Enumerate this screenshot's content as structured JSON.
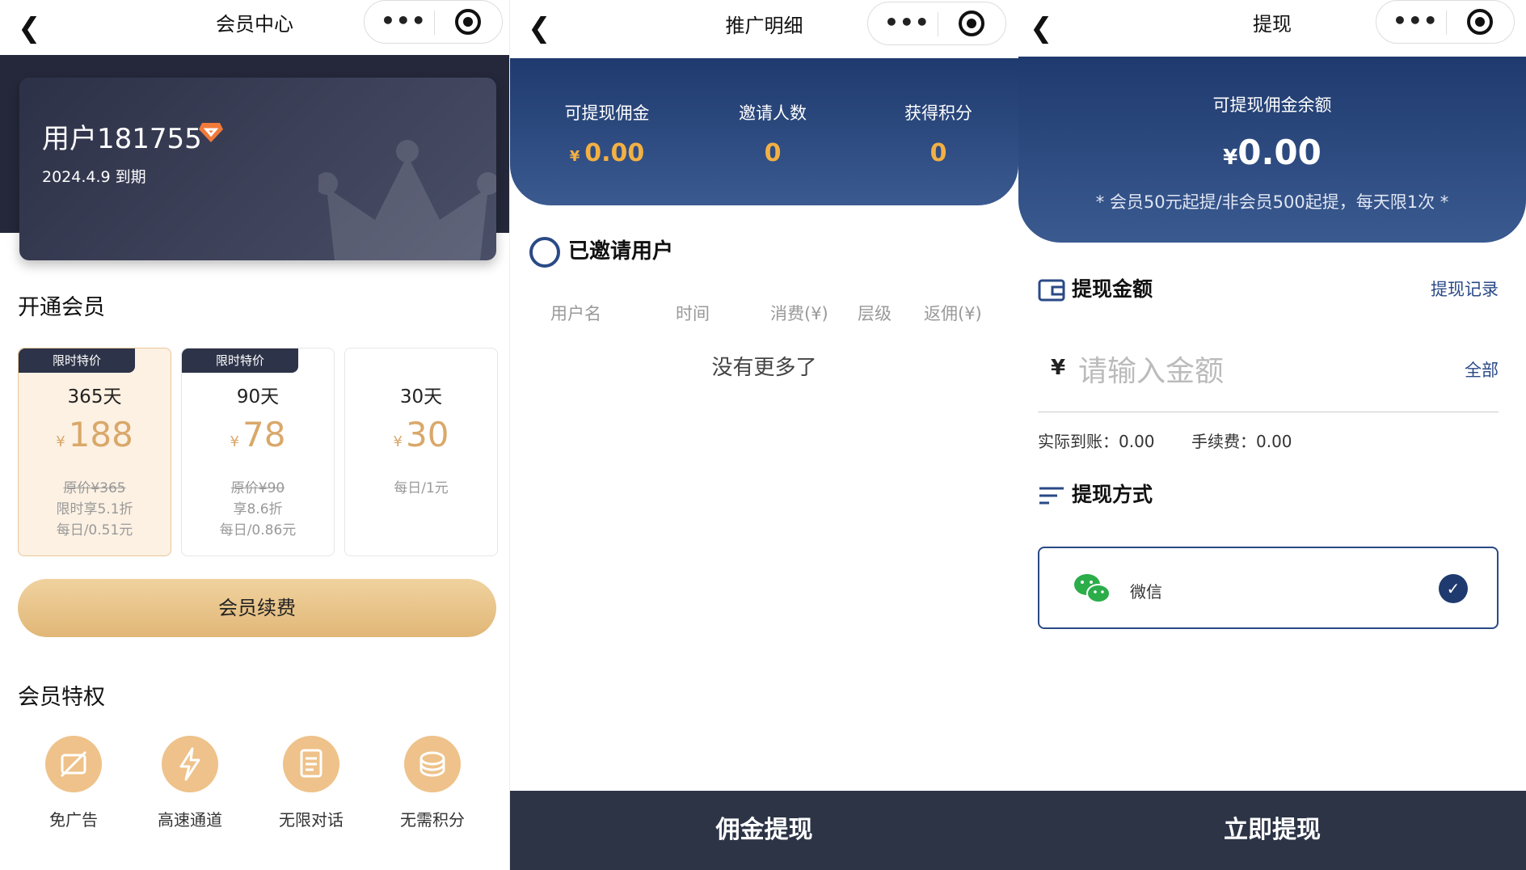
{
  "screen1": {
    "title": "会员中心",
    "user": {
      "name": "用户181755",
      "expiry": "2024.4.9 到期"
    },
    "open_title": "开通会员",
    "plans": [
      {
        "badge": "限时特价",
        "days": "365天",
        "currency": "¥",
        "price": "188",
        "orig": "原价¥365",
        "discount": "限时享5.1折",
        "daily": "每日/0.51元",
        "selected": true
      },
      {
        "badge": "限时特价",
        "days": "90天",
        "currency": "¥",
        "price": "78",
        "orig": "原价¥90",
        "discount": "享8.6折",
        "daily": "每日/0.86元",
        "selected": false
      },
      {
        "badge": "",
        "days": "30天",
        "currency": "¥",
        "price": "30",
        "orig": "",
        "discount": "",
        "daily": "每日/1元",
        "selected": false
      }
    ],
    "renew_label": "会员续费",
    "priv_title": "会员特权",
    "privileges": [
      {
        "label": "免广告",
        "icon": "no-ad-icon"
      },
      {
        "label": "高速通道",
        "icon": "lightning-icon"
      },
      {
        "label": "无限对话",
        "icon": "document-icon"
      },
      {
        "label": "无需积分",
        "icon": "coins-icon"
      }
    ],
    "colors": {
      "gold": "#d9a86a",
      "dark": "#2d3147"
    }
  },
  "screen2": {
    "title": "推广明细",
    "stats": [
      {
        "label": "可提现佣金",
        "currency": "¥",
        "value": "0.00"
      },
      {
        "label": "邀请人数",
        "currency": "",
        "value": "0"
      },
      {
        "label": "获得积分",
        "currency": "",
        "value": "0"
      }
    ],
    "section_title": "已邀请用户",
    "columns": [
      "用户名",
      "时间",
      "消费(¥)",
      "层级",
      "返佣(¥)"
    ],
    "empty": "没有更多了",
    "bottom_button": "佣金提现"
  },
  "screen3": {
    "title": "提现",
    "balance_label": "可提现佣金余额",
    "currency": "¥",
    "balance": "0.00",
    "note": "* 会员50元起提/非会员500起提，每天限1次 *",
    "amount_title": "提现金额",
    "record_link": "提现记录",
    "input_placeholder": "请输入金额",
    "all_label": "全部",
    "actual": "实际到账：0.00",
    "fee": "手续费：0.00",
    "method_title": "提现方式",
    "method": "微信",
    "bottom_button": "立即提现",
    "colors": {
      "navy": "#1f3a6e",
      "bar": "#2c3446"
    }
  }
}
